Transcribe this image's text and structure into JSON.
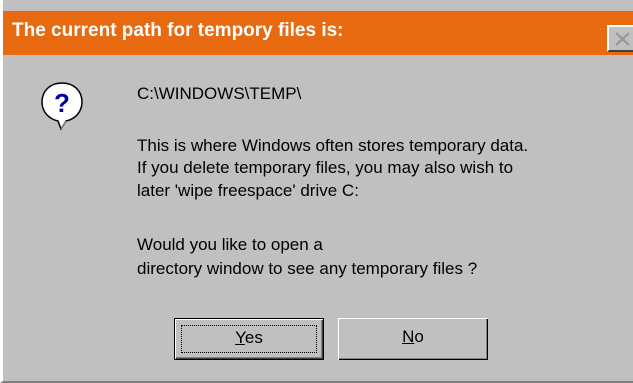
{
  "dialog": {
    "title": "The current path for tempory files is:",
    "icon": "question-icon",
    "path": "C:\\WINDOWS\\TEMP\\",
    "description_lines": [
      "This is where Windows often stores temporary data.",
      "If you delete temporary files, you may also wish to",
      "later 'wipe freespace' drive C:"
    ],
    "question_lines": [
      "Would you like to open a",
      "directory window to see any temporary files ?"
    ],
    "buttons": {
      "yes": {
        "accel": "Y",
        "rest": "es"
      },
      "no": {
        "accel": "N",
        "rest": "o"
      }
    }
  },
  "colors": {
    "titlebar": "#e86a10",
    "face": "#c0c0c0",
    "title_text": "#ffffff"
  }
}
